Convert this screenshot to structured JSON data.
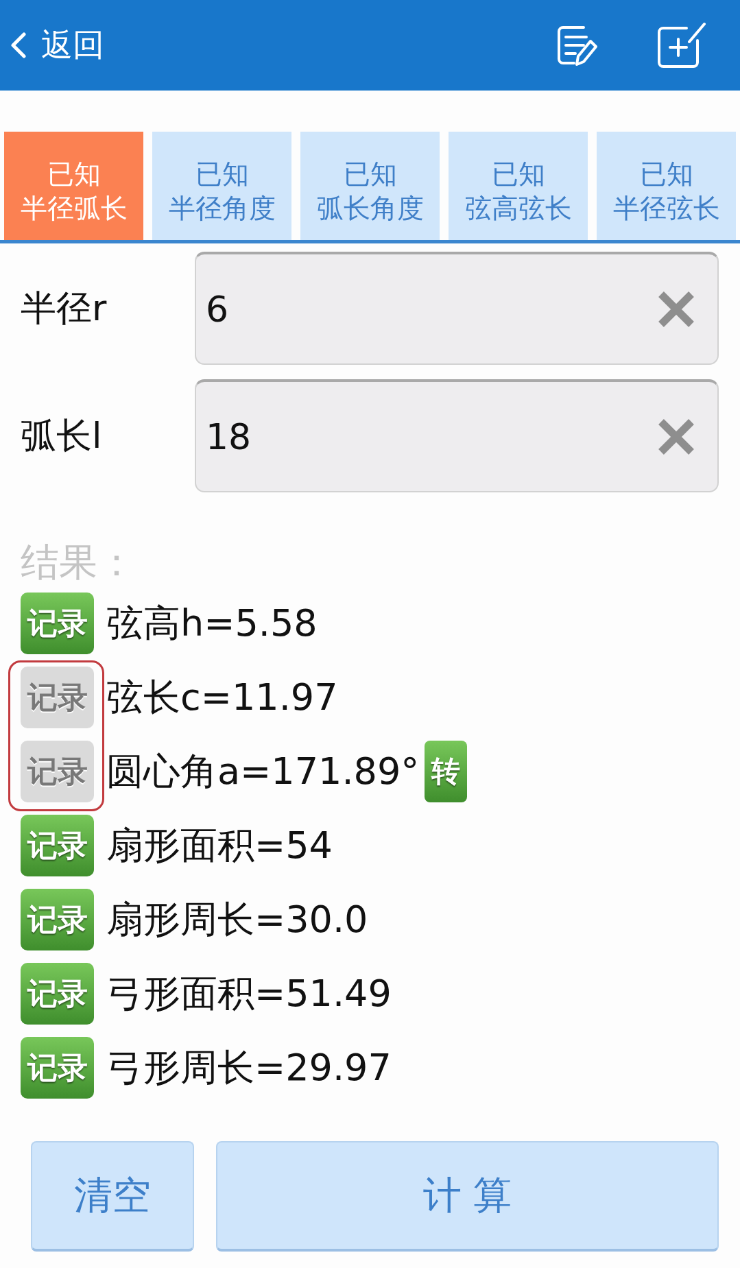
{
  "header": {
    "back_label": "返回"
  },
  "tabs": [
    {
      "line1": "已知",
      "line2": "半径弧长",
      "selected": true
    },
    {
      "line1": "已知",
      "line2": "半径角度",
      "selected": false
    },
    {
      "line1": "已知",
      "line2": "弧长角度",
      "selected": false
    },
    {
      "line1": "已知",
      "line2": "弦高弦长",
      "selected": false
    },
    {
      "line1": "已知",
      "line2": "半径弦长",
      "selected": false
    }
  ],
  "inputs": [
    {
      "label": "半径r",
      "value": "6"
    },
    {
      "label": "弧长l",
      "value": "18"
    }
  ],
  "results_label": "结果：",
  "results": [
    {
      "record_label": "记录",
      "text": "弦高h=5.58",
      "disabled": false,
      "highlighted": false
    },
    {
      "record_label": "记录",
      "text": "弦长c=11.97",
      "disabled": true,
      "highlighted": true
    },
    {
      "record_label": "记录",
      "text": "圆心角a=171.89°",
      "disabled": true,
      "highlighted": true,
      "convert_label": "转"
    },
    {
      "record_label": "记录",
      "text": "扇形面积=54",
      "disabled": false,
      "highlighted": false
    },
    {
      "record_label": "记录",
      "text": "扇形周长=30.0",
      "disabled": false,
      "highlighted": false
    },
    {
      "record_label": "记录",
      "text": "弓形面积=51.49",
      "disabled": false,
      "highlighted": false
    },
    {
      "record_label": "记录",
      "text": "弓形周长=29.97",
      "disabled": false,
      "highlighted": false
    }
  ],
  "buttons": [
    {
      "label": "清空",
      "kind": "clear"
    },
    {
      "label": "计 算",
      "kind": "calculate"
    }
  ]
}
